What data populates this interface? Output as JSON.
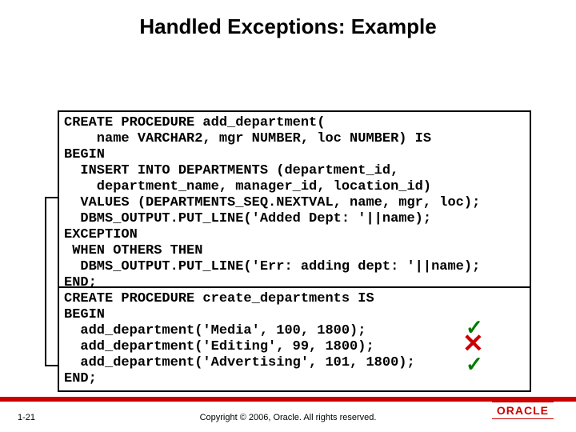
{
  "title": "Handled Exceptions: Example",
  "code1": "CREATE PROCEDURE add_department(\n    name VARCHAR2, mgr NUMBER, loc NUMBER) IS\nBEGIN\n  INSERT INTO DEPARTMENTS (department_id,\n    department_name, manager_id, location_id)\n  VALUES (DEPARTMENTS_SEQ.NEXTVAL, name, mgr, loc);\n  DBMS_OUTPUT.PUT_LINE('Added Dept: '||name);\nEXCEPTION\n WHEN OTHERS THEN\n  DBMS_OUTPUT.PUT_LINE('Err: adding dept: '||name);\nEND;",
  "code2": "CREATE PROCEDURE create_departments IS\nBEGIN\n  add_department('Media', 100, 1800);\n  add_department('Editing', 99, 1800);\n  add_department('Advertising', 101, 1800);\nEND;",
  "marks": {
    "check1": "✓",
    "cross": "✕",
    "check2": "✓"
  },
  "footer": {
    "page": "1-21",
    "copyright": "Copyright © 2006, Oracle. All rights reserved.",
    "logo": "ORACLE"
  }
}
